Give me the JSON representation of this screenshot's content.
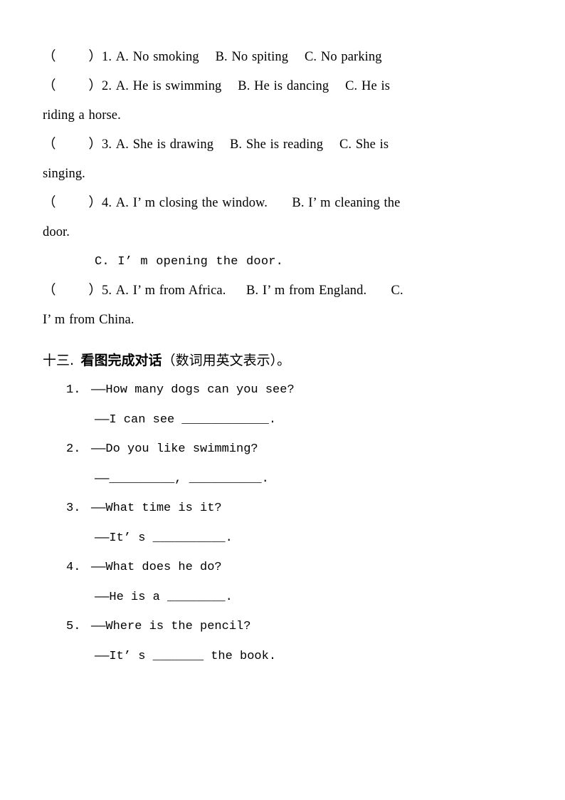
{
  "document": {
    "type": "english-exam-worksheet",
    "page_background": "#ffffff",
    "text_color": "#000000"
  },
  "multiple_choice": {
    "lines": [
      "（        ）1. A. No smoking    B. No spiting    C. No parking",
      "（        ）2. A. He is swimming    B. He is dancing    C. He is",
      "riding a horse.",
      "（        ）3. A. She is drawing    B. She is reading    C. She is",
      "singing.",
      "（        ）4. A. I’ m closing the window.      B. I’ m cleaning the",
      "door.",
      "C. I’ m opening the door.",
      "（        ）5. A. I’ m from Africa.     B. I’ m from England.      C.",
      "I’ m from China."
    ],
    "items": [
      {
        "number": "1.",
        "bracket": "（        ）",
        "options": [
          {
            "label": "A.",
            "text": "No smoking"
          },
          {
            "label": "B.",
            "text": "No spiting"
          },
          {
            "label": "C.",
            "text": "No parking"
          }
        ]
      },
      {
        "number": "2.",
        "bracket": "（        ）",
        "options": [
          {
            "label": "A.",
            "text": "He is swimming"
          },
          {
            "label": "B.",
            "text": "He is dancing"
          },
          {
            "label": "C.",
            "text": "He is riding a horse."
          }
        ]
      },
      {
        "number": "3.",
        "bracket": "（        ）",
        "options": [
          {
            "label": "A.",
            "text": "She is drawing"
          },
          {
            "label": "B.",
            "text": "She is reading"
          },
          {
            "label": "C.",
            "text": "She is singing."
          }
        ]
      },
      {
        "number": "4.",
        "bracket": "（        ）",
        "options": [
          {
            "label": "A.",
            "text": "I’ m closing the window."
          },
          {
            "label": "B.",
            "text": "I’ m cleaning the door."
          },
          {
            "label": "C.",
            "text": "I’ m opening the door."
          }
        ]
      },
      {
        "number": "5.",
        "bracket": "（        ）",
        "options": [
          {
            "label": "A.",
            "text": "I’ m from Africa."
          },
          {
            "label": "B.",
            "text": "I’ m from England."
          },
          {
            "label": "C.",
            "text": "I’ m from China."
          }
        ]
      }
    ]
  },
  "section_thirteen": {
    "heading_number": "十三.",
    "heading_title": "看图完成对话",
    "heading_note": "（数词用英文表示）。",
    "heading_full": "十三.  看图完成对话（数词用英文表示）。",
    "dialogues": [
      {
        "number": "1.",
        "question": "——How many dogs can you see?",
        "answer": "——I can see ____________."
      },
      {
        "number": "2.",
        "question": "——Do you like swimming?",
        "answer": "——_________, __________."
      },
      {
        "number": "3.",
        "question": "——What time is it?",
        "answer": "——It’ s __________."
      },
      {
        "number": "4.",
        "question": "——What does he do?",
        "answer": "——He is a ________."
      },
      {
        "number": "5.",
        "question": "——Where is the pencil?",
        "answer": "——It’ s _______ the book."
      }
    ]
  }
}
